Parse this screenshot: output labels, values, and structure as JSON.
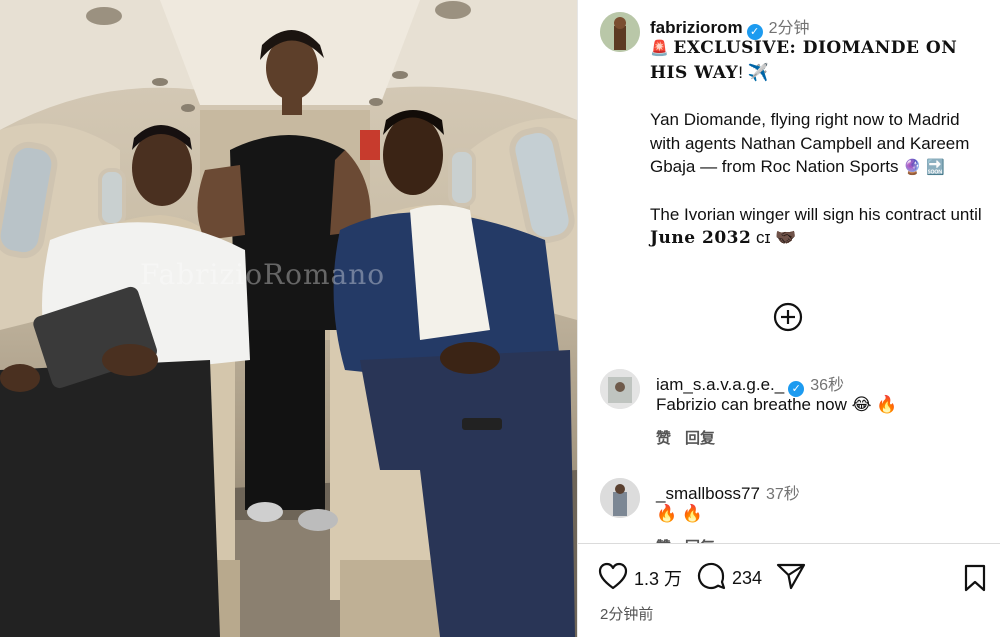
{
  "photo": {
    "watermark": "FabrizioRomano"
  },
  "post": {
    "username": "fabriziorom",
    "time": "2分钟",
    "headline_prefix": "🚨",
    "headline": "EXCLUSIVE: DIOMANDE ON HIS WAY",
    "headline_suffix": "! ✈️",
    "paragraph1": "Yan Diomande, flying right now to Madrid with agents Nathan Campbell and Kareem Gbaja — from Roc Nation Sports",
    "paragraph1_emoji": "🔮 🔜",
    "paragraph2_start": "The Ivorian winger will sign his contract until",
    "paragraph2_bold": "June 2032",
    "paragraph2_end": "ᴄɪ 🤝🏿"
  },
  "comments": [
    {
      "username": "iam_s.a.v.a.g.e._",
      "verified": true,
      "time": "36秒",
      "text": "Fabrizio can breathe now 😂 🔥",
      "like_label": "赞",
      "reply_label": "回复"
    },
    {
      "username": "_smallboss77",
      "verified": false,
      "time": "37秒",
      "text": "🔥 🔥",
      "like_label": "赞",
      "reply_label": "回复"
    }
  ],
  "footer": {
    "likes": "1.3 万",
    "comments": "234",
    "posted": "2分钟前"
  },
  "icons": {
    "verified": "verified-badge-icon",
    "add_comment": "plus-circle-icon",
    "like": "heart-icon",
    "comment": "comment-bubble-icon",
    "share": "send-icon",
    "save": "bookmark-icon"
  },
  "colors": {
    "verified": "#1d9bf0",
    "text": "#111111",
    "muted": "#737373"
  }
}
